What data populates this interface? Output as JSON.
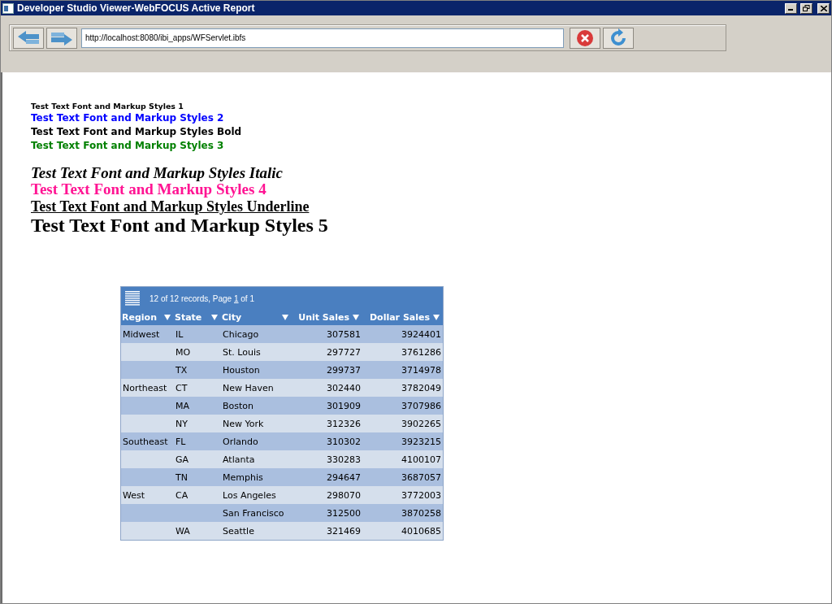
{
  "window": {
    "title": "Developer Studio Viewer-WebFOCUS Active Report"
  },
  "toolbar": {
    "address": "http://localhost:8080/ibi_apps/WFServlet.ibfs"
  },
  "text_lines": [
    {
      "kind": "small",
      "text": "Test Text Font and Markup Styles 1"
    },
    {
      "kind": "blue",
      "text": "Test Text Font and Markup Styles 2"
    },
    {
      "kind": "bold",
      "text": "Test Text Font and Markup Styles Bold"
    },
    {
      "kind": "green",
      "text": "Test Text Font and Markup Styles 3"
    },
    {
      "kind": "italic",
      "text": "Test Text Font and Markup Styles Italic"
    },
    {
      "kind": "pink",
      "text": "Test Text Font and Markup Styles 4"
    },
    {
      "kind": "underline",
      "text": "Test Text Font and Markup Styles Underline"
    },
    {
      "kind": "large",
      "text": "Test Text Font and Markup Styles 5"
    }
  ],
  "report": {
    "pager": {
      "summary": "12 of 12 records, Page",
      "page": "1",
      "total": "of 1"
    },
    "columns": [
      "Region",
      "State",
      "City",
      "Unit Sales",
      "Dollar Sales"
    ],
    "rows": [
      [
        "Midwest",
        "IL",
        "Chicago",
        "307581",
        "3924401"
      ],
      [
        null,
        "MO",
        "St. Louis",
        "297727",
        "3761286"
      ],
      [
        null,
        "TX",
        "Houston",
        "299737",
        "3714978"
      ],
      [
        "Northeast",
        "CT",
        "New Haven",
        "302440",
        "3782049"
      ],
      [
        null,
        "MA",
        "Boston",
        "301909",
        "3707986"
      ],
      [
        null,
        "NY",
        "New York",
        "312326",
        "3902265"
      ],
      [
        "Southeast",
        "FL",
        "Orlando",
        "310302",
        "3923215"
      ],
      [
        null,
        "GA",
        "Atlanta",
        "330283",
        "4100107"
      ],
      [
        null,
        "TN",
        "Memphis",
        "294647",
        "3687057"
      ],
      [
        "West",
        "CA",
        "Los Angeles",
        "298070",
        "3772003"
      ],
      [
        null,
        null,
        "San Francisco",
        "312500",
        "3870258"
      ],
      [
        null,
        "WA",
        "Seattle",
        "321469",
        "4010685"
      ]
    ]
  }
}
